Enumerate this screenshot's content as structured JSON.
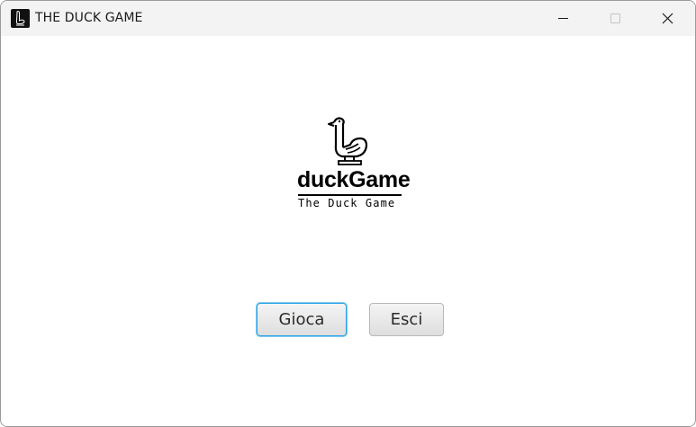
{
  "window": {
    "title": "THE DUCK GAME",
    "controls": {
      "minimize": "minimize-icon",
      "maximize": "maximize-icon",
      "close": "close-icon"
    }
  },
  "logo": {
    "name": "duckGame",
    "tagline": "The Duck Game"
  },
  "buttons": {
    "play_label": "Gioca",
    "exit_label": "Esci"
  },
  "colors": {
    "titlebar_bg": "#f3f3f3",
    "focus_ring": "#2aa2e6",
    "button_bg": "#e6e6e6",
    "text": "#1a1a1a"
  }
}
